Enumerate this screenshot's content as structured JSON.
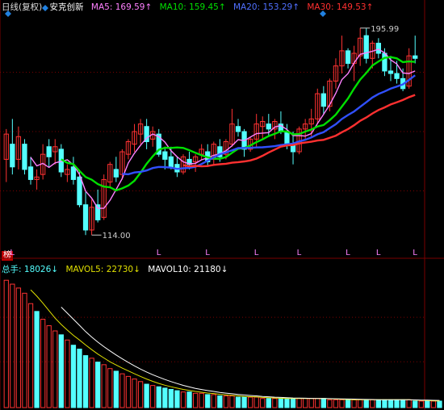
{
  "header": {
    "period": "日线(复权)",
    "name": "安克创新",
    "ma5_label": "MA5:",
    "ma5": "169.59↑",
    "ma10_label": "MA10:",
    "ma10": "159.45↑",
    "ma20_label": "MA20:",
    "ma20": "153.29↑",
    "ma30_label": "MA30:",
    "ma30": "149.53↑"
  },
  "volume_header": {
    "total_label": "总手:",
    "total": "18026↓",
    "mavol5_label": "MAVOL5:",
    "mavol5": "22730↓",
    "mavol10_label": "MAVOL10:",
    "mavol10": "21180↓"
  },
  "period_tag": "榜",
  "colors": {
    "up": "#ff3232",
    "down": "#54ffff",
    "ma5": "#ff80ff",
    "ma10": "#00e000",
    "ma20": "#3050ff",
    "ma30": "#ff3030",
    "mavol5": "#e0e000",
    "mavol10": "#ffffff",
    "grid": "#7a0000",
    "diamond": "#2080e0"
  },
  "chart_data": [
    {
      "type": "candlestick",
      "title": "安克创新",
      "ylim": [
        108,
        202
      ],
      "annotations": [
        {
          "label": "195.99",
          "value": 195.99,
          "index": 58
        },
        {
          "label": "114.00",
          "value": 114.0,
          "index": 14
        }
      ],
      "markers": [
        "L",
        "L",
        "L",
        "L",
        "L",
        "L",
        "L",
        "L"
      ],
      "marker_indexes": [
        1,
        25,
        33,
        41,
        48,
        56,
        61,
        67
      ],
      "candles": [
        {
          "o": 144,
          "h": 156,
          "l": 135,
          "c": 154
        },
        {
          "o": 150,
          "h": 160,
          "l": 138,
          "c": 141
        },
        {
          "o": 144,
          "h": 157,
          "l": 140,
          "c": 153
        },
        {
          "o": 150,
          "h": 152,
          "l": 138,
          "c": 140
        },
        {
          "o": 141,
          "h": 145,
          "l": 134,
          "c": 136
        },
        {
          "o": 136,
          "h": 140,
          "l": 132,
          "c": 137
        },
        {
          "o": 138,
          "h": 150,
          "l": 136,
          "c": 146
        },
        {
          "o": 149,
          "h": 152,
          "l": 141,
          "c": 145
        },
        {
          "o": 147,
          "h": 152,
          "l": 142,
          "c": 149
        },
        {
          "o": 148,
          "h": 150,
          "l": 137,
          "c": 139
        },
        {
          "o": 138,
          "h": 142,
          "l": 135,
          "c": 140
        },
        {
          "o": 141,
          "h": 145,
          "l": 134,
          "c": 136
        },
        {
          "o": 137,
          "h": 139,
          "l": 125,
          "c": 126
        },
        {
          "o": 126,
          "h": 131,
          "l": 114,
          "c": 116
        },
        {
          "o": 116,
          "h": 128,
          "l": 114,
          "c": 125
        },
        {
          "o": 126,
          "h": 132,
          "l": 119,
          "c": 120
        },
        {
          "o": 121,
          "h": 138,
          "l": 120,
          "c": 136
        },
        {
          "o": 135,
          "h": 143,
          "l": 133,
          "c": 142
        },
        {
          "o": 140,
          "h": 145,
          "l": 135,
          "c": 137
        },
        {
          "o": 138,
          "h": 148,
          "l": 136,
          "c": 147
        },
        {
          "o": 146,
          "h": 152,
          "l": 144,
          "c": 151
        },
        {
          "o": 150,
          "h": 158,
          "l": 147,
          "c": 155
        },
        {
          "o": 154,
          "h": 160,
          "l": 150,
          "c": 158
        },
        {
          "o": 157,
          "h": 160,
          "l": 148,
          "c": 151
        },
        {
          "o": 152,
          "h": 157,
          "l": 149,
          "c": 155
        },
        {
          "o": 154,
          "h": 156,
          "l": 145,
          "c": 146
        },
        {
          "o": 147,
          "h": 149,
          "l": 140,
          "c": 144
        },
        {
          "o": 145,
          "h": 149,
          "l": 140,
          "c": 141
        },
        {
          "o": 142,
          "h": 145,
          "l": 137,
          "c": 139
        },
        {
          "o": 139,
          "h": 146,
          "l": 138,
          "c": 145
        },
        {
          "o": 144,
          "h": 147,
          "l": 140,
          "c": 142
        },
        {
          "o": 143,
          "h": 146,
          "l": 139,
          "c": 145
        },
        {
          "o": 146,
          "h": 150,
          "l": 144,
          "c": 148
        },
        {
          "o": 147,
          "h": 150,
          "l": 141,
          "c": 143
        },
        {
          "o": 144,
          "h": 151,
          "l": 142,
          "c": 150
        },
        {
          "o": 149,
          "h": 152,
          "l": 143,
          "c": 145
        },
        {
          "o": 146,
          "h": 152,
          "l": 144,
          "c": 151
        },
        {
          "o": 150,
          "h": 164,
          "l": 149,
          "c": 158
        },
        {
          "o": 157,
          "h": 160,
          "l": 153,
          "c": 155
        },
        {
          "o": 155,
          "h": 156,
          "l": 145,
          "c": 148
        },
        {
          "o": 148,
          "h": 153,
          "l": 147,
          "c": 152
        },
        {
          "o": 152,
          "h": 162,
          "l": 149,
          "c": 158
        },
        {
          "o": 157,
          "h": 161,
          "l": 152,
          "c": 159
        },
        {
          "o": 158,
          "h": 162,
          "l": 153,
          "c": 156
        },
        {
          "o": 156,
          "h": 160,
          "l": 152,
          "c": 159
        },
        {
          "o": 158,
          "h": 163,
          "l": 154,
          "c": 155
        },
        {
          "o": 155,
          "h": 158,
          "l": 148,
          "c": 150
        },
        {
          "o": 150,
          "h": 155,
          "l": 142,
          "c": 147
        },
        {
          "o": 147,
          "h": 157,
          "l": 146,
          "c": 156
        },
        {
          "o": 156,
          "h": 160,
          "l": 152,
          "c": 158
        },
        {
          "o": 158,
          "h": 164,
          "l": 153,
          "c": 160
        },
        {
          "o": 160,
          "h": 172,
          "l": 158,
          "c": 170
        },
        {
          "o": 170,
          "h": 173,
          "l": 162,
          "c": 165
        },
        {
          "o": 165,
          "h": 176,
          "l": 163,
          "c": 175
        },
        {
          "o": 175,
          "h": 184,
          "l": 172,
          "c": 181
        },
        {
          "o": 181,
          "h": 193,
          "l": 178,
          "c": 187
        },
        {
          "o": 187,
          "h": 188,
          "l": 180,
          "c": 182
        },
        {
          "o": 182,
          "h": 189,
          "l": 175,
          "c": 186
        },
        {
          "o": 185,
          "h": 196,
          "l": 181,
          "c": 192
        },
        {
          "o": 193,
          "h": 196,
          "l": 182,
          "c": 184
        },
        {
          "o": 184,
          "h": 191,
          "l": 180,
          "c": 190
        },
        {
          "o": 190,
          "h": 192,
          "l": 184,
          "c": 186
        },
        {
          "o": 186,
          "h": 188,
          "l": 177,
          "c": 179
        },
        {
          "o": 179,
          "h": 185,
          "l": 175,
          "c": 178
        },
        {
          "o": 178,
          "h": 183,
          "l": 174,
          "c": 176
        },
        {
          "o": 176,
          "h": 180,
          "l": 171,
          "c": 172
        },
        {
          "o": 173,
          "h": 188,
          "l": 172,
          "c": 185
        },
        {
          "o": 185,
          "h": 193,
          "l": 182,
          "c": 184
        }
      ]
    },
    {
      "type": "bar",
      "title": "总手",
      "ylim": [
        0,
        100
      ],
      "values": [
        98,
        95,
        92,
        88,
        80,
        74,
        68,
        63,
        59,
        56,
        52,
        48,
        45,
        40,
        38,
        35,
        33,
        30,
        28,
        26,
        24,
        22,
        20,
        18,
        17,
        16,
        15,
        14,
        13,
        12,
        12,
        11,
        11,
        10,
        10,
        9,
        9,
        9,
        8,
        8,
        8,
        8,
        7,
        7,
        7,
        7,
        7,
        7,
        7,
        7,
        7,
        7,
        7,
        6,
        6,
        6,
        6,
        6,
        6,
        6,
        6,
        6,
        6,
        6,
        6,
        6,
        6,
        5,
        5,
        5,
        5,
        5
      ],
      "up": [
        1,
        1,
        1,
        1,
        1,
        0,
        1,
        1,
        1,
        0,
        1,
        0,
        0,
        0,
        1,
        0,
        1,
        1,
        0,
        1,
        1,
        1,
        1,
        0,
        1,
        0,
        0,
        0,
        0,
        1,
        0,
        1,
        1,
        0,
        1,
        0,
        1,
        1,
        0,
        0,
        1,
        1,
        1,
        0,
        1,
        0,
        0,
        0,
        1,
        1,
        1,
        1,
        0,
        1,
        1,
        1,
        0,
        1,
        1,
        0,
        1,
        0,
        0,
        0,
        0,
        0,
        1,
        0,
        1,
        0,
        1,
        0
      ]
    }
  ]
}
